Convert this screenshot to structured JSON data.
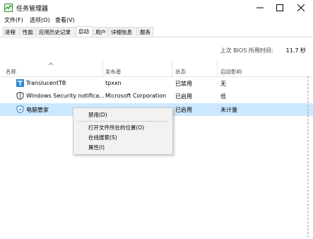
{
  "window": {
    "title": "任务管理器"
  },
  "menu": [
    "文件(F)",
    "选项(O)",
    "查看(V)"
  ],
  "tabs": [
    "进程",
    "性能",
    "应用历史记录",
    "启动",
    "用户",
    "详细信息",
    "服务"
  ],
  "active_tab": "启动",
  "bios": {
    "label": "上次 BIOS 所用时间:",
    "value": "11.7 秒"
  },
  "columns": {
    "name": "名称",
    "publisher": "发布者",
    "status": "状态",
    "impact": "启动影响"
  },
  "rows": [
    {
      "icon": "translucenttb-icon",
      "name": "TranslucentTB",
      "publisher": "tpxxn",
      "status": "已禁用",
      "impact": "无"
    },
    {
      "icon": "shield-icon",
      "name": "Windows Security notifica...",
      "publisher": "Microsoft Corporation",
      "status": "已启用",
      "impact": "低"
    },
    {
      "icon": "pc-manager-icon",
      "name": "电脑管家",
      "publisher": "",
      "status": "已启用",
      "impact": "未计量"
    }
  ],
  "context_menu": [
    "禁用(D)",
    "打开文件所在的位置(O)",
    "在线搜索(S)",
    "属性(I)"
  ],
  "colors": {
    "selection": "#cce8ff",
    "accent": "#1e78d7"
  }
}
